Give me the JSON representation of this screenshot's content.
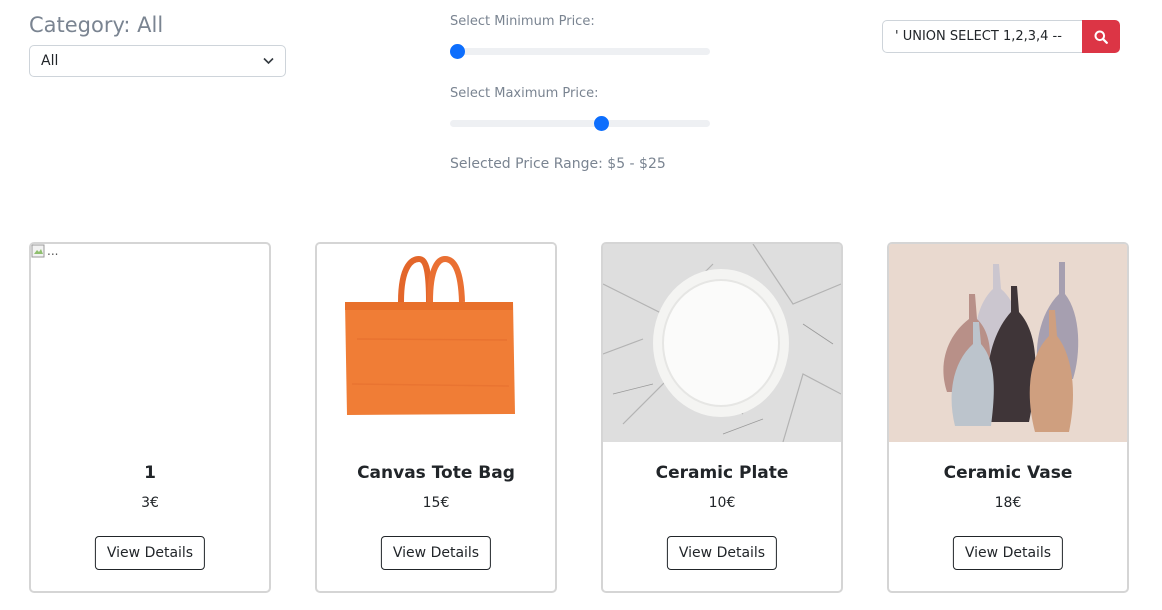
{
  "filters": {
    "category_title": "Category: All",
    "category_selected": "All",
    "min_label": "Select Minimum Price:",
    "max_label": "Select Maximum Price:",
    "min_value_fraction": 0.0,
    "max_value_fraction": 0.58,
    "range_text": "Selected Price Range: $5 - $25"
  },
  "search": {
    "value": "' UNION SELECT 1,2,3,4 --"
  },
  "colors": {
    "accent_blue": "#0d6efd",
    "search_button": "#dc3545"
  },
  "products": [
    {
      "name": "1",
      "price": "3€",
      "button": "View Details",
      "image_alt": "...",
      "image": "broken-image"
    },
    {
      "name": "Canvas Tote Bag",
      "price": "15€",
      "button": "View Details",
      "image": "orange-tote-bag"
    },
    {
      "name": "Ceramic Plate",
      "price": "10€",
      "button": "View Details",
      "image": "white-plate-on-marble"
    },
    {
      "name": "Ceramic Vase",
      "price": "18€",
      "button": "View Details",
      "image": "ceramic-vases"
    }
  ]
}
